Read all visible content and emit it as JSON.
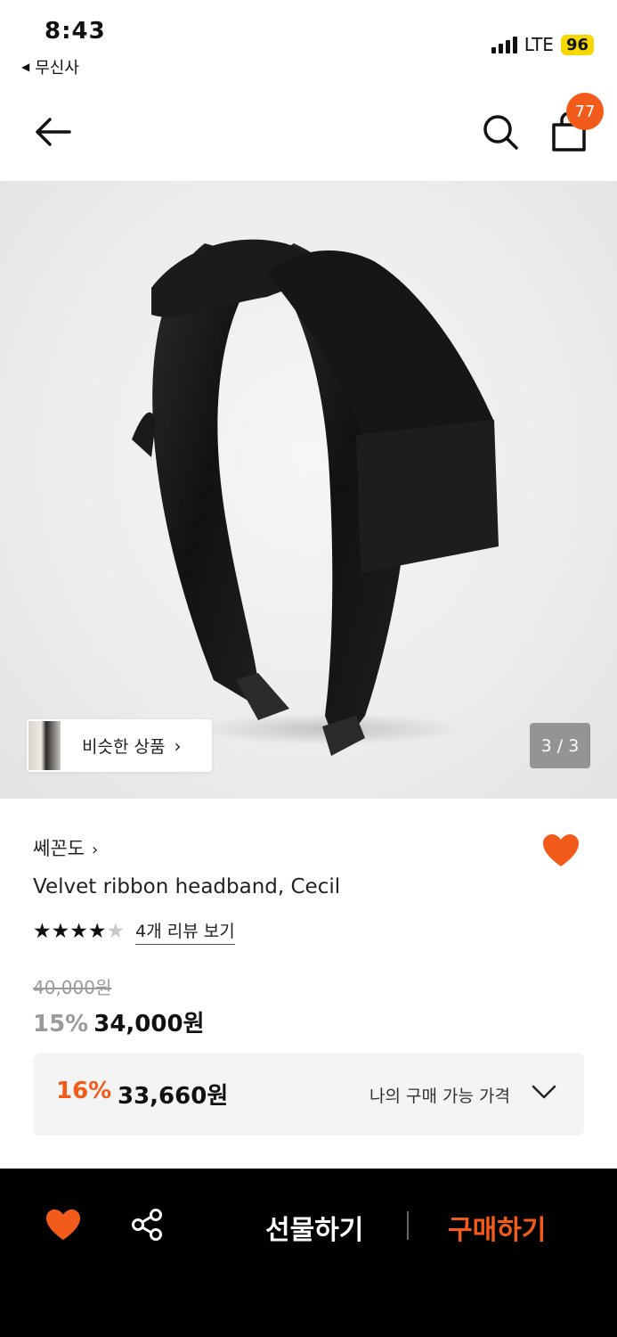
{
  "status_bar": {
    "time": "8:43",
    "back_app": "무신사",
    "network": "LTE",
    "battery": "96"
  },
  "nav": {
    "cart_count": "77",
    "icons": [
      "back-arrow-icon",
      "search-icon",
      "shopping-bag-icon"
    ]
  },
  "gallery": {
    "similar_label": "비슷한 상품",
    "pager": "3 / 3"
  },
  "product": {
    "brand": "쎄꼰도",
    "name": "Velvet ribbon headband, Cecil",
    "rating_stars": 4,
    "rating_max": 5,
    "review_link": "4개 리뷰 보기",
    "original_price": "40,000원",
    "discount": "15%",
    "price": "34,000원"
  },
  "my_price": {
    "discount": "16%",
    "price": "33,660원",
    "label": "나의 구매 가능 가격"
  },
  "bottom_bar": {
    "gift_label": "선물하기",
    "buy_label": "구매하기"
  },
  "colors": {
    "accent": "#f35b1b",
    "battery": "#f5d800",
    "bottom_bar": "#000000"
  }
}
